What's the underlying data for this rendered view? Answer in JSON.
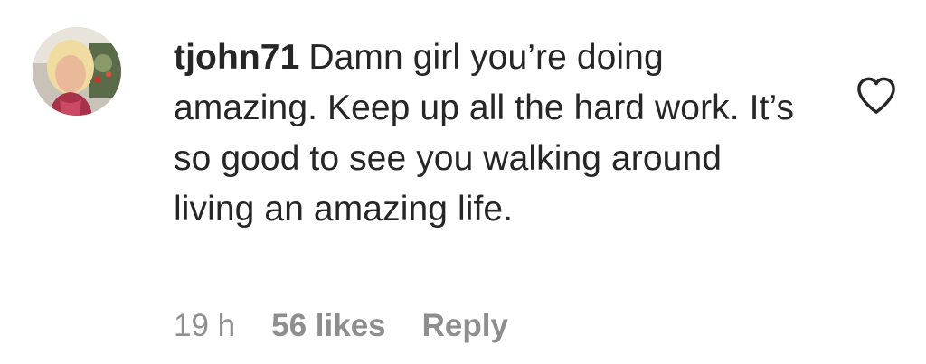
{
  "comment": {
    "avatar_icon": "user-avatar",
    "username": "tjohn71",
    "text": "Damn girl you’re doing amazing. Keep up all the hard work. It’s so good to see you walking around living an amazing life.",
    "timestamp": "19 h",
    "likes": "56 likes",
    "reply_label": "Reply",
    "like_icon": "heart-outline-icon"
  },
  "colors": {
    "text": "#262626",
    "meta": "#8e8e8e",
    "background": "#ffffff"
  }
}
